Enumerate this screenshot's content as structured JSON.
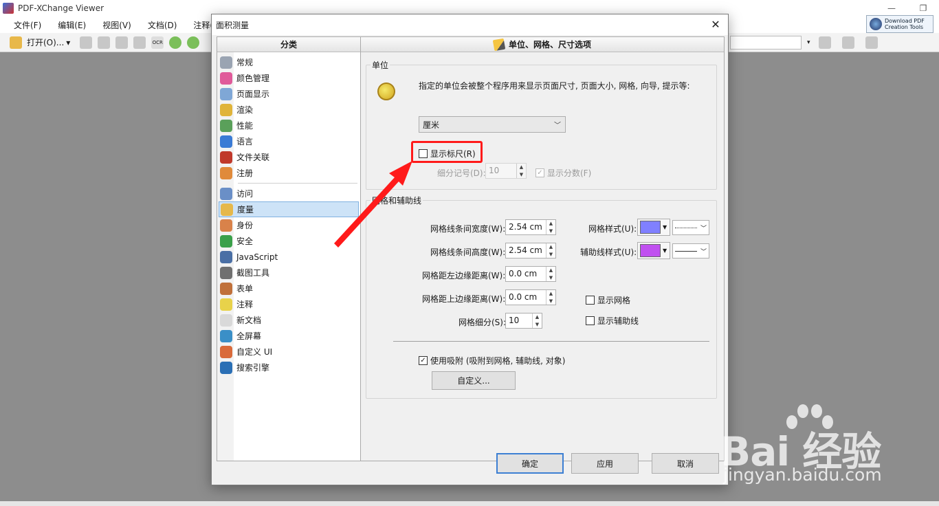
{
  "app": {
    "title": "PDF-XChange Viewer",
    "menu": [
      "文件(F)",
      "编辑(E)",
      "视图(V)",
      "文档(D)",
      "注释(C)"
    ],
    "open_label": "打开(O)...",
    "download_line1": "Download PDF",
    "download_line2": "Creation Tools",
    "win_min": "—",
    "win_restore": "❐",
    "ocr_label": "OCR"
  },
  "dialog": {
    "title": "面积测量",
    "close": "✕",
    "left_header": "分类",
    "right_header": "单位、网格、尺寸选项",
    "categories_a": [
      {
        "label": "常规",
        "icon": "gear-icon",
        "color": "#9aa4b2"
      },
      {
        "label": "颜色管理",
        "icon": "color-palette-icon",
        "color": "#e05a9a"
      },
      {
        "label": "页面显示",
        "icon": "page-view-icon",
        "color": "#7fa7d6"
      },
      {
        "label": "渲染",
        "icon": "paint-icon",
        "color": "#e0b43a"
      },
      {
        "label": "性能",
        "icon": "chart-icon",
        "color": "#5aa05a"
      },
      {
        "label": "语言",
        "icon": "globe-icon",
        "color": "#3a7bd5"
      },
      {
        "label": "文件关联",
        "icon": "file-assoc-icon",
        "color": "#c0392b"
      },
      {
        "label": "注册",
        "icon": "user-icon",
        "color": "#e08a3a"
      }
    ],
    "categories_b": [
      {
        "label": "访问",
        "icon": "network-icon",
        "color": "#6a8fc7"
      },
      {
        "label": "度量",
        "icon": "ruler-icon",
        "color": "#e6b84a"
      },
      {
        "label": "身份",
        "icon": "identity-icon",
        "color": "#d9824a"
      },
      {
        "label": "安全",
        "icon": "shield-icon",
        "color": "#3aa04a"
      },
      {
        "label": "JavaScript",
        "icon": "javascript-icon",
        "color": "#4a6fa5"
      },
      {
        "label": "截图工具",
        "icon": "camera-icon",
        "color": "#707070"
      },
      {
        "label": "表单",
        "icon": "form-icon",
        "color": "#c0703a"
      },
      {
        "label": "注释",
        "icon": "comment-icon",
        "color": "#e8d24a"
      },
      {
        "label": "新文档",
        "icon": "new-document-icon",
        "color": "#d9d9d9"
      },
      {
        "label": "全屏幕",
        "icon": "fullscreen-icon",
        "color": "#3a8fc7"
      },
      {
        "label": "自定义 UI",
        "icon": "customize-ui-icon",
        "color": "#d96a3a"
      },
      {
        "label": "搜索引擎",
        "icon": "search-engine-icon",
        "color": "#2a6fb5"
      }
    ],
    "selected_category": "度量",
    "units": {
      "group_label": "单位",
      "description": "指定的单位会被整个程序用来显示页面尺寸, 页面大小, 网格, 向导, 提示等:",
      "selected_unit": "厘米",
      "show_ruler_label": "显示标尺(R)",
      "show_ruler_checked": "",
      "subdivisions_label": "细分记号(D):",
      "subdivisions_value": "10",
      "show_fractions_label": "显示分数(F)",
      "show_fractions_check": "✓"
    },
    "grid": {
      "group_label": "网格和辅助线",
      "width_label": "网格线条间宽度(W):",
      "width_value": "2.54 cm",
      "height_label": "网格线条间高度(W):",
      "height_value": "2.54 cm",
      "left_label": "网格距左边缘距离(W):",
      "left_value": "0.0 cm",
      "top_label": "网格距上边缘距离(W):",
      "top_value": "0.0 cm",
      "subdiv_label": "网格细分(S):",
      "subdiv_value": "10",
      "grid_style_label": "网格样式(U):",
      "grid_color": "#8080ff",
      "guide_style_label": "辅助线样式(U):",
      "guide_color": "#c050f0",
      "show_grid_label": "显示网格",
      "show_guides_label": "显示辅助线",
      "snap_label": "使用吸附 (吸附到网格, 辅助线, 对象)",
      "snap_check": "✓",
      "customize_label": "自定义..."
    },
    "buttons": {
      "ok": "确定",
      "apply": "应用",
      "cancel": "取消"
    }
  },
  "annotation_color": "#ff1a1a",
  "watermark": {
    "brand": "Bai  经验",
    "site": "jingyan.baidu.com"
  }
}
